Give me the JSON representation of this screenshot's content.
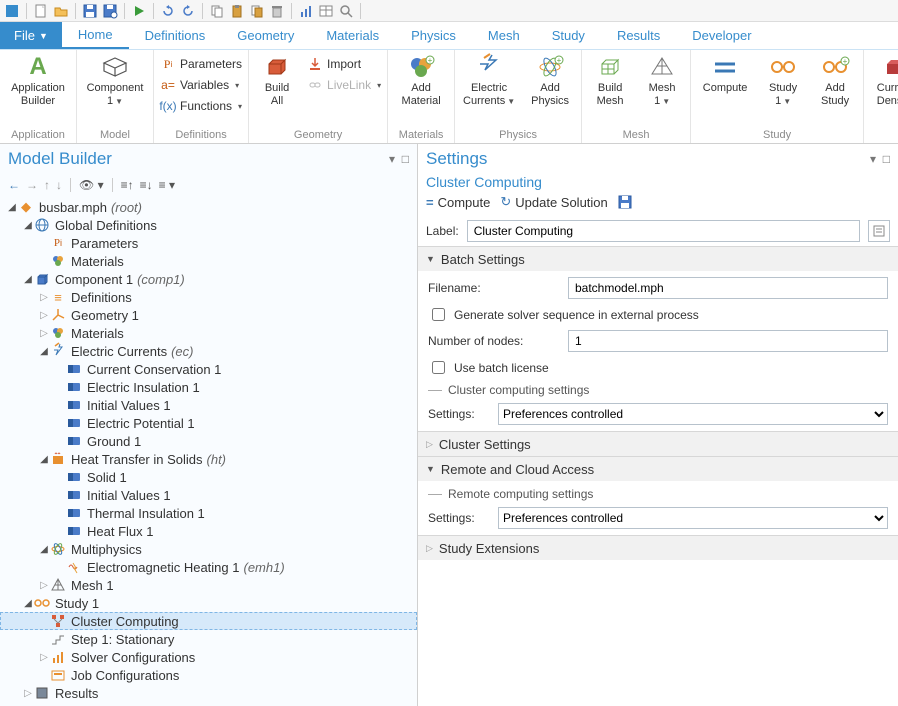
{
  "menubar": {
    "file": "File",
    "tabs": [
      "Home",
      "Definitions",
      "Geometry",
      "Materials",
      "Physics",
      "Mesh",
      "Study",
      "Results",
      "Developer"
    ],
    "active": 0
  },
  "ribbon": {
    "groups": {
      "application": {
        "label": "Application",
        "btn": "Application\nBuilder"
      },
      "model": {
        "label": "Model",
        "btn": "Component\n1"
      },
      "definitions": {
        "label": "Definitions",
        "parameters": "Parameters",
        "variables": "Variables",
        "functions": "Functions"
      },
      "geometry": {
        "label": "Geometry",
        "build": "Build\nAll",
        "import": "Import",
        "livelink": "LiveLink"
      },
      "materials": {
        "label": "Materials",
        "btn": "Add\nMaterial"
      },
      "physics": {
        "label": "Physics",
        "electric": "Electric\nCurrents",
        "add": "Add\nPhysics"
      },
      "mesh": {
        "label": "Mesh",
        "build": "Build\nMesh",
        "mesh1": "Mesh\n1"
      },
      "study": {
        "label": "Study",
        "compute": "Compute",
        "study1": "Study\n1",
        "add": "Add\nStudy"
      },
      "results": {
        "density": "Current\nDensity"
      }
    }
  },
  "left": {
    "title": "Model Builder",
    "tree": {
      "root": {
        "label": "busbar.mph",
        "suffix": "(root)"
      },
      "globaldef": "Global Definitions",
      "params": "Parameters",
      "mats": "Materials",
      "comp1": {
        "label": "Component 1",
        "suffix": "(comp1)"
      },
      "defs": "Definitions",
      "geom1": "Geometry 1",
      "cmats": "Materials",
      "ec": {
        "label": "Electric Currents",
        "suffix": "(ec)"
      },
      "cc1": "Current Conservation 1",
      "ei1": "Electric Insulation 1",
      "iv1": "Initial Values 1",
      "ep1": "Electric Potential 1",
      "gnd1": "Ground 1",
      "ht": {
        "label": "Heat Transfer in Solids",
        "suffix": "(ht)"
      },
      "solid1": "Solid 1",
      "htiv1": "Initial Values 1",
      "ti1": "Thermal Insulation 1",
      "hf1": "Heat Flux 1",
      "mp": "Multiphysics",
      "emh1": {
        "label": "Electromagnetic Heating 1",
        "suffix": "(emh1)"
      },
      "mesh1": "Mesh 1",
      "study1": "Study 1",
      "cluster": "Cluster Computing",
      "step1": "Step 1: Stationary",
      "solver": "Solver Configurations",
      "job": "Job Configurations",
      "results": "Results"
    }
  },
  "right": {
    "title": "Settings",
    "subtitle": "Cluster Computing",
    "actions": {
      "compute": "Compute",
      "update": "Update Solution"
    },
    "label_lbl": "Label:",
    "label_val": "Cluster Computing",
    "sections": {
      "batch": {
        "title": "Batch Settings",
        "filename_lbl": "Filename:",
        "filename_val": "batchmodel.mph",
        "gen_chk": "Generate solver sequence in external process",
        "nodes_lbl": "Number of nodes:",
        "nodes_val": "1",
        "usebatch": "Use batch license",
        "ccs": "Cluster computing settings",
        "settings_lbl": "Settings:",
        "settings_val": "Preferences controlled"
      },
      "cluster": {
        "title": "Cluster Settings"
      },
      "remote": {
        "title": "Remote and Cloud Access",
        "rcs": "Remote computing settings",
        "settings_lbl": "Settings:",
        "settings_val": "Preferences controlled"
      },
      "ext": {
        "title": "Study Extensions"
      }
    }
  }
}
